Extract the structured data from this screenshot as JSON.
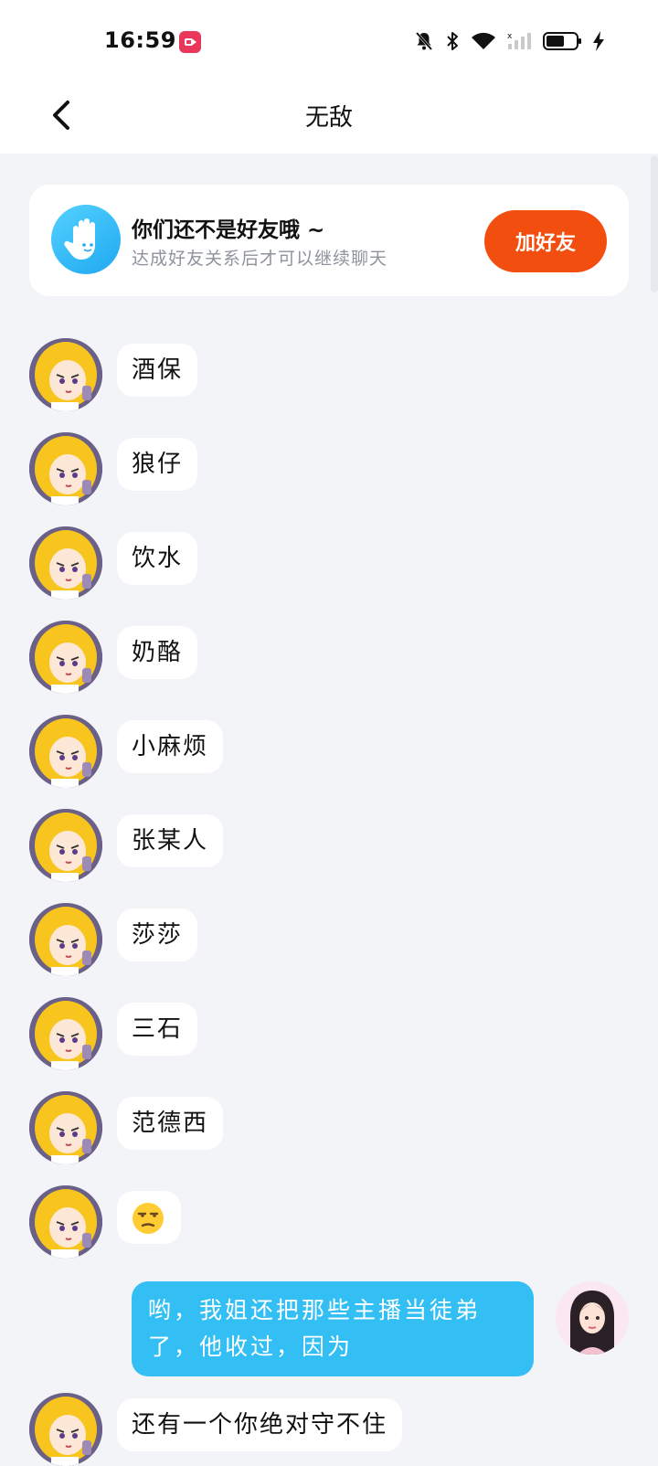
{
  "status_bar": {
    "time": "16:59",
    "battery_level_percent": 55,
    "icons": [
      "screen-record-icon",
      "notification-muted-icon",
      "bluetooth-icon",
      "wifi-icon",
      "cellular-signal-icon",
      "battery-icon",
      "charging-icon"
    ]
  },
  "header": {
    "title": "无敌",
    "back_icon": "chevron-left-icon"
  },
  "friend_card": {
    "title": "你们还不是好友哦 ~",
    "subtitle": "达成好友关系后才可以继续聊天",
    "button_label": "加好友",
    "icon": "hand-wave-icon"
  },
  "colors": {
    "background": "#f3f4f8",
    "accent_orange": "#f24e0f",
    "outgoing_bubble": "#33bff3",
    "card_icon": "#1fa9f0"
  },
  "messages": [
    {
      "side": "in",
      "text": "酒保"
    },
    {
      "side": "in",
      "text": "狼仔"
    },
    {
      "side": "in",
      "text": "饮水"
    },
    {
      "side": "in",
      "text": "奶酪"
    },
    {
      "side": "in",
      "text": "小麻烦"
    },
    {
      "side": "in",
      "text": "张某人"
    },
    {
      "side": "in",
      "text": "莎莎"
    },
    {
      "side": "in",
      "text": "三石"
    },
    {
      "side": "in",
      "text": "范德西"
    },
    {
      "side": "in",
      "emoji": "unamused-face-emoji"
    },
    {
      "side": "out",
      "text": "哟，我姐还把那些主播当徒弟了，他收过，因为"
    },
    {
      "side": "in",
      "text": "还有一个你绝对守不住"
    }
  ]
}
